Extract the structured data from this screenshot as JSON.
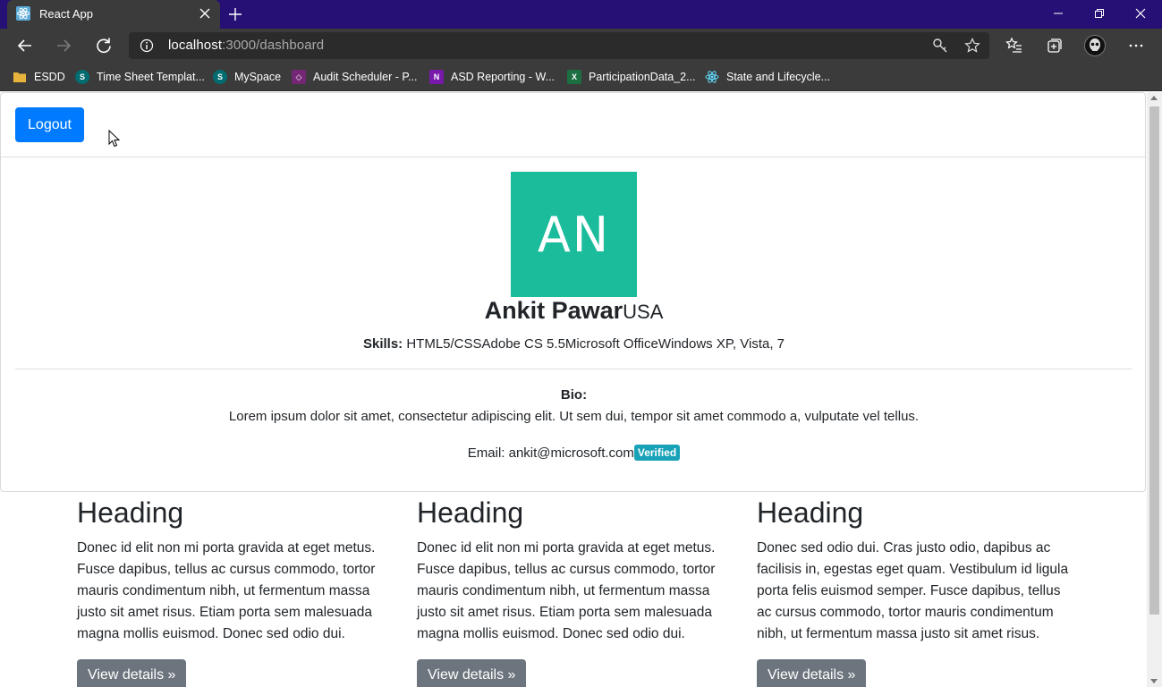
{
  "browser": {
    "tab_title": "React App",
    "url_host": "localhost",
    "url_rest": ":3000/dashboard"
  },
  "bookmarks": [
    {
      "label": "ESDD",
      "icon": "folder-icon",
      "color": "#e8b53c"
    },
    {
      "label": "Time Sheet Templat...",
      "icon": "sharepoint-icon",
      "color": "#036c70"
    },
    {
      "label": "MySpace",
      "icon": "sharepoint-icon",
      "color": "#036c70"
    },
    {
      "label": "Audit Scheduler - P...",
      "icon": "powerapps-icon",
      "color": "#742774"
    },
    {
      "label": "ASD Reporting - W...",
      "icon": "onenote-icon",
      "color": "#7719aa"
    },
    {
      "label": "ParticipationData_2...",
      "icon": "excel-icon",
      "color": "#1d6f42"
    },
    {
      "label": "State and Lifecycle...",
      "icon": "react-icon",
      "color": "#61dafb"
    }
  ],
  "page": {
    "logout_label": "Logout",
    "initials": "AN",
    "name": "Ankit Pawar",
    "country": "USA",
    "skills_label": "Skills:",
    "skills": "HTML5/CSSAdobe CS 5.5Microsoft OfficeWindows XP, Vista, 7",
    "bio_label": "Bio:",
    "bio": "Lorem ipsum dolor sit amet, consectetur adipiscing elit. Ut sem dui, tempor sit amet commodo a, vulputate vel tellus.",
    "email_prefix": "Email: ",
    "email": "ankit@microsoft.com",
    "badge": "Verified"
  },
  "columns": [
    {
      "heading": "Heading",
      "text": "Donec id elit non mi porta gravida at eget metus. Fusce dapibus, tellus ac cursus commodo, tortor mauris condimentum nibh, ut fermentum massa justo sit amet risus. Etiam porta sem malesuada magna mollis euismod. Donec sed odio dui.",
      "button": "View details »"
    },
    {
      "heading": "Heading",
      "text": "Donec id elit non mi porta gravida at eget metus. Fusce dapibus, tellus ac cursus commodo, tortor mauris condimentum nibh, ut fermentum massa justo sit amet risus. Etiam porta sem malesuada magna mollis euismod. Donec sed odio dui.",
      "button": "View details »"
    },
    {
      "heading": "Heading",
      "text": "Donec sed odio dui. Cras justo odio, dapibus ac facilisis in, egestas eget quam. Vestibulum id ligula porta felis euismod semper. Fusce dapibus, tellus ac cursus commodo, tortor mauris condimentum nibh, ut fermentum massa justo sit amet risus.",
      "button": "View details »"
    }
  ],
  "colors": {
    "titlebar": "#261076",
    "chrome": "#3b3b3b",
    "primary": "#007bff",
    "avatar_bg": "#1abc9c",
    "badge": "#17a2b8",
    "secondary": "#6c757d"
  }
}
